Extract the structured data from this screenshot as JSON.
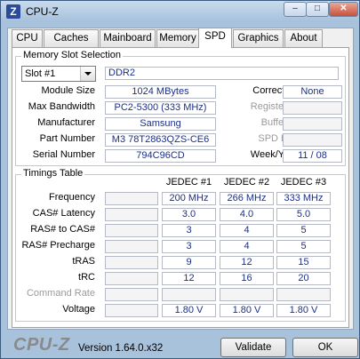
{
  "window": {
    "title": "CPU-Z",
    "app_icon_letter": "Z",
    "min": "–",
    "max": "□",
    "close": "✕"
  },
  "tabs": [
    "CPU",
    "Caches",
    "Mainboard",
    "Memory",
    "SPD",
    "Graphics",
    "About"
  ],
  "active_tab": "SPD",
  "memory_slot": {
    "title": "Memory Slot Selection",
    "slot_selected": "Slot #1",
    "type": "DDR2",
    "labels": {
      "module_size": "Module Size",
      "max_bandwidth": "Max Bandwidth",
      "manufacturer": "Manufacturer",
      "part_number": "Part Number",
      "serial_number": "Serial Number",
      "correction": "Correction",
      "registered": "Registered",
      "buffered": "Buffered",
      "spd_ext": "SPD Ext.",
      "week_year": "Week/Year"
    },
    "values": {
      "module_size": "1024 MBytes",
      "max_bandwidth": "PC2-5300 (333 MHz)",
      "manufacturer": "Samsung",
      "part_number": "M3 78T2863QZS-CE6",
      "serial_number": "794C96CD",
      "correction": "None",
      "registered": "",
      "buffered": "",
      "spd_ext": "",
      "week_year": "11 / 08"
    }
  },
  "timings": {
    "title": "Timings Table",
    "columns": [
      "JEDEC #1",
      "JEDEC #2",
      "JEDEC #3"
    ],
    "rows": [
      {
        "label": "Frequency",
        "values": [
          "200 MHz",
          "266 MHz",
          "333 MHz"
        ]
      },
      {
        "label": "CAS# Latency",
        "values": [
          "3.0",
          "4.0",
          "5.0"
        ]
      },
      {
        "label": "RAS# to CAS#",
        "values": [
          "3",
          "4",
          "5"
        ]
      },
      {
        "label": "RAS# Precharge",
        "values": [
          "3",
          "4",
          "5"
        ]
      },
      {
        "label": "tRAS",
        "values": [
          "9",
          "12",
          "15"
        ]
      },
      {
        "label": "tRC",
        "values": [
          "12",
          "16",
          "20"
        ]
      },
      {
        "label": "Command Rate",
        "values": [
          "",
          "",
          ""
        ]
      },
      {
        "label": "Voltage",
        "values": [
          "1.80 V",
          "1.80 V",
          "1.80 V"
        ]
      }
    ]
  },
  "footer": {
    "brand": "CPU-Z",
    "version": "Version 1.64.0.x32",
    "validate": "Validate",
    "ok": "OK"
  }
}
